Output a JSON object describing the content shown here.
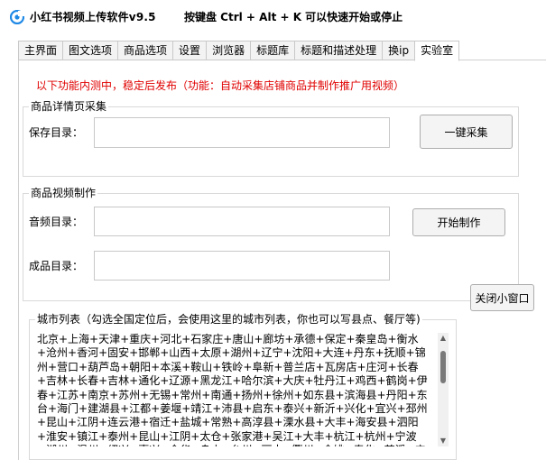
{
  "window": {
    "title": "小红书视频上传软件v9.5",
    "hotkey_hint": "按键盘 Ctrl + Alt + K  可以快速开始或停止",
    "icon": "app-logo-icon"
  },
  "tabs": [
    {
      "label": "主界面",
      "active": false
    },
    {
      "label": "图文选项",
      "active": false
    },
    {
      "label": "商品选项",
      "active": false
    },
    {
      "label": "设置",
      "active": false
    },
    {
      "label": "浏览器",
      "active": false
    },
    {
      "label": "标题库",
      "active": false
    },
    {
      "label": "标题和描述处理",
      "active": false
    },
    {
      "label": "换ip",
      "active": false
    },
    {
      "label": "实验室",
      "active": true
    }
  ],
  "lab": {
    "notice": "以下功能内测中，稳定后发布（功能：自动采集店铺商品并制作推广用视频）",
    "notice_color": "#e00000",
    "product_detail": {
      "title": "商品详情页采集",
      "save_dir_label": "保存目录：",
      "save_dir_value": "",
      "collect_button": "一键采集"
    },
    "product_video": {
      "title": "商品视频制作",
      "audio_dir_label": "音频目录：",
      "audio_dir_value": "",
      "output_dir_label": "成品目录：",
      "output_dir_value": "",
      "start_button": "开始制作"
    },
    "close_button": "关闭小窗口",
    "city_list": {
      "title": "城市列表（勾选全国定位后，会使用这里的城市列表，你也可以写县点、餐厅等)",
      "value": "北京+上海+天津+重庆+河北+石家庄+唐山+廊坊+承德+保定+秦皇岛+衡水+沧州+香河+固安+邯郸+山西+太原+湖州+辽宁+沈阳+大连+丹东+抚顺+锦州+营口+葫芦岛+朝阳+本溪+鞍山+铁岭+阜新+普兰店+瓦房店+庄河+长春+吉林+长春+吉林+通化+辽源+黑龙江+哈尔滨+大庆+牡丹江+鸡西+鹤岗+伊春+江苏+南京+苏州+无锡+常州+南通+扬州+徐州+如东县+滨海县+丹阳+东台+海门+建湖县+江都+姜堰+靖江+沛县+启东+泰兴+新沂+兴化+宜兴+邳州+昆山+江阴+连云港+宿迁+盐城+常熟+高淳县+溧水县+大丰+海安县+泗阳+淮安+镇江+泰州+昆山+江阴+太仓+张家港+吴江+大丰+杭江+杭州+宁波+湖州+温州+绍兴+嘉兴+金华+舟山+台州+丽水+衢州+余姚+奉化+慈溪+宁海县+象山县+桐庐县+淳安县+建德+富阳+临安+诸暨+海宁+上虞+嵊州+平湖+嘉善县+海宁+诸暨+瑞安+义乌+安徽+合肥+芜湖+淮北+蚌埠+马鞍山+安庆+宣城+池州+肥东+肥西+铜陵+淮南+滁州+宿州+阜阳+宿州"
    }
  },
  "colors": {
    "accent": "#1e88e5",
    "border": "#d0d0d0",
    "notice": "#e00000"
  }
}
